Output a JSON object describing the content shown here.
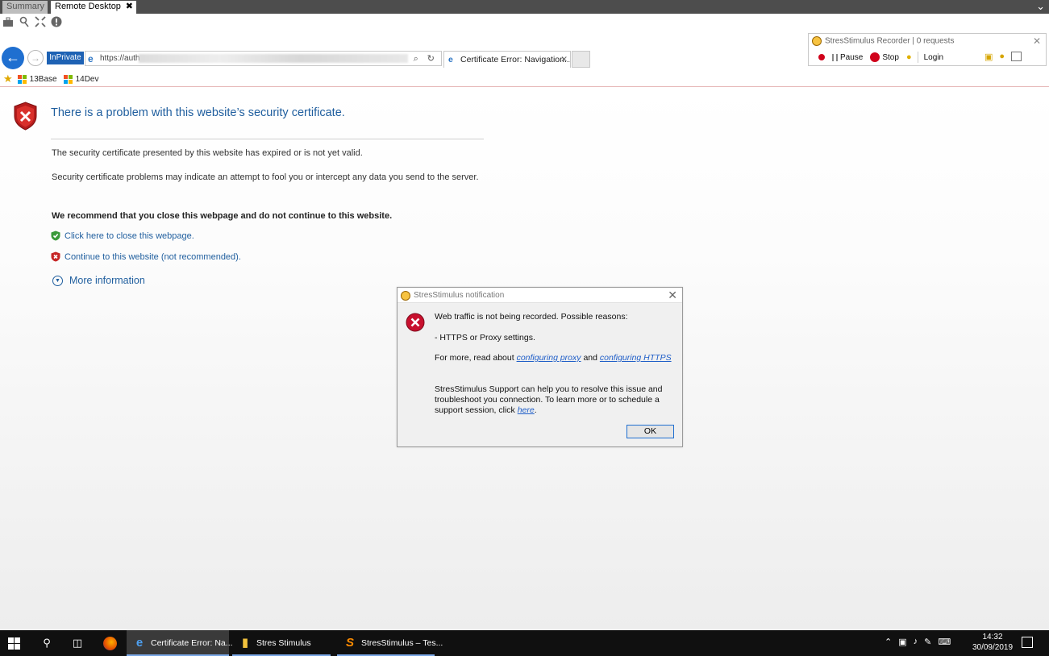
{
  "remote_desktop": {
    "tabs": [
      {
        "label": "Summary"
      },
      {
        "label": "Remote Desktop"
      }
    ],
    "close_glyph": "✖",
    "collapse_glyph": "⌄",
    "tool_icons": [
      "toolbox-icon",
      "pin-icon",
      "fullscreen-icon",
      "info-icon"
    ]
  },
  "browser": {
    "inprivate_label": "InPrivate",
    "address": {
      "url_visible": "https://auth",
      "controls": "⌕ ↻"
    },
    "tab": {
      "title": "Certificate Error: Navigation...",
      "close": "✕"
    },
    "favorites": [
      {
        "label": "13Base"
      },
      {
        "label": "14Dev"
      }
    ]
  },
  "recorder": {
    "title": "StresStimulus Recorder | 0 requests",
    "close": "✕",
    "pause_label": "Pause",
    "stop_label": "Stop",
    "login_label": "Login"
  },
  "page": {
    "title": "There is a problem with this website’s security certificate.",
    "para1": "The security certificate presented by this website has expired or is not yet valid.",
    "para2": "Security certificate problems may indicate an attempt to fool you or intercept any data you send to the server.",
    "recommend": "We recommend that you close this webpage and do not continue to this website.",
    "close_link": "Click here to close this webpage.",
    "continue_link": "Continue to this website (not recommended).",
    "more_info": "More information"
  },
  "dialog": {
    "title": "StresStimulus notification",
    "line1": "Web traffic is not being recorded. Possible reasons:",
    "line2": "- HTTPS or Proxy settings.",
    "line3_prefix": "For more, read about ",
    "link_proxy": "configuring proxy",
    "line3_mid": " and ",
    "link_https": "configuring HTTPS",
    "line4_prefix": "StresStimulus Support can help you to resolve this issue and troubleshoot you connection. To learn more or to schedule a support session, click ",
    "link_here": "here",
    "line4_suffix": ".",
    "ok_label": "OK"
  },
  "taskbar": {
    "apps": [
      {
        "label": "Certificate Error: Na...",
        "icon": "ie-icon"
      },
      {
        "label": "Stres Stimulus",
        "icon": "folder-icon"
      },
      {
        "label": "StresStimulus – Tes...",
        "icon": "stresstimulus-icon"
      }
    ],
    "time": "14:32",
    "date": "30/09/2019"
  },
  "colors": {
    "link_blue": "#1f5e9e",
    "inprivate_blue": "#1e62b4",
    "error_red": "#d0021b"
  }
}
